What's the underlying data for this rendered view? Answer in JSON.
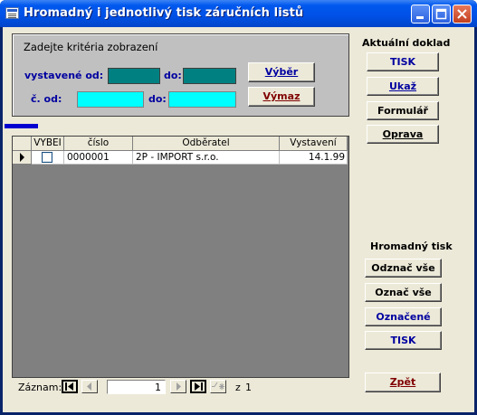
{
  "window": {
    "title": "Hromadný i jednotlivý tisk záručních listů",
    "controls": [
      "minimize-icon",
      "maximize-icon",
      "close-icon"
    ]
  },
  "criteria": {
    "heading": "Zadejte kritéria zobrazení",
    "issued_from_label": "vystavené od:",
    "issued_from_value": "",
    "issued_to_label": "do:",
    "issued_to_value": "",
    "number_from_label": "č. od:",
    "number_from_value": "",
    "number_to_label": "do:",
    "number_to_value": "",
    "select_button": "Výběr",
    "clear_button": "Výmaz"
  },
  "current_doc": {
    "heading": "Aktuální doklad",
    "buttons": [
      "TISK",
      "Ukaž",
      "Formulář",
      "Oprava"
    ]
  },
  "bulk_print": {
    "heading": "Hromadný tisk",
    "buttons": [
      "Odznač vše",
      "Označ vše",
      "Označené",
      "TISK"
    ]
  },
  "back_button": "Zpět",
  "table": {
    "columns": [
      "VYBEI",
      "číslo",
      "Odběratel",
      "Vystavení"
    ],
    "rows": [
      {
        "selected": false,
        "number": "0000001",
        "customer": "2P - IMPORT s.r.o.",
        "issued": "14.1.99"
      }
    ]
  },
  "record_nav": {
    "label": "Záznam:",
    "current": "1",
    "of_label": "z",
    "total": "1"
  },
  "colors": {
    "title_bar": "#0054e3",
    "date_field": "#008080",
    "number_field": "#00ffff",
    "label_blue": "#0000a0",
    "clear_button_text": "#800000"
  }
}
